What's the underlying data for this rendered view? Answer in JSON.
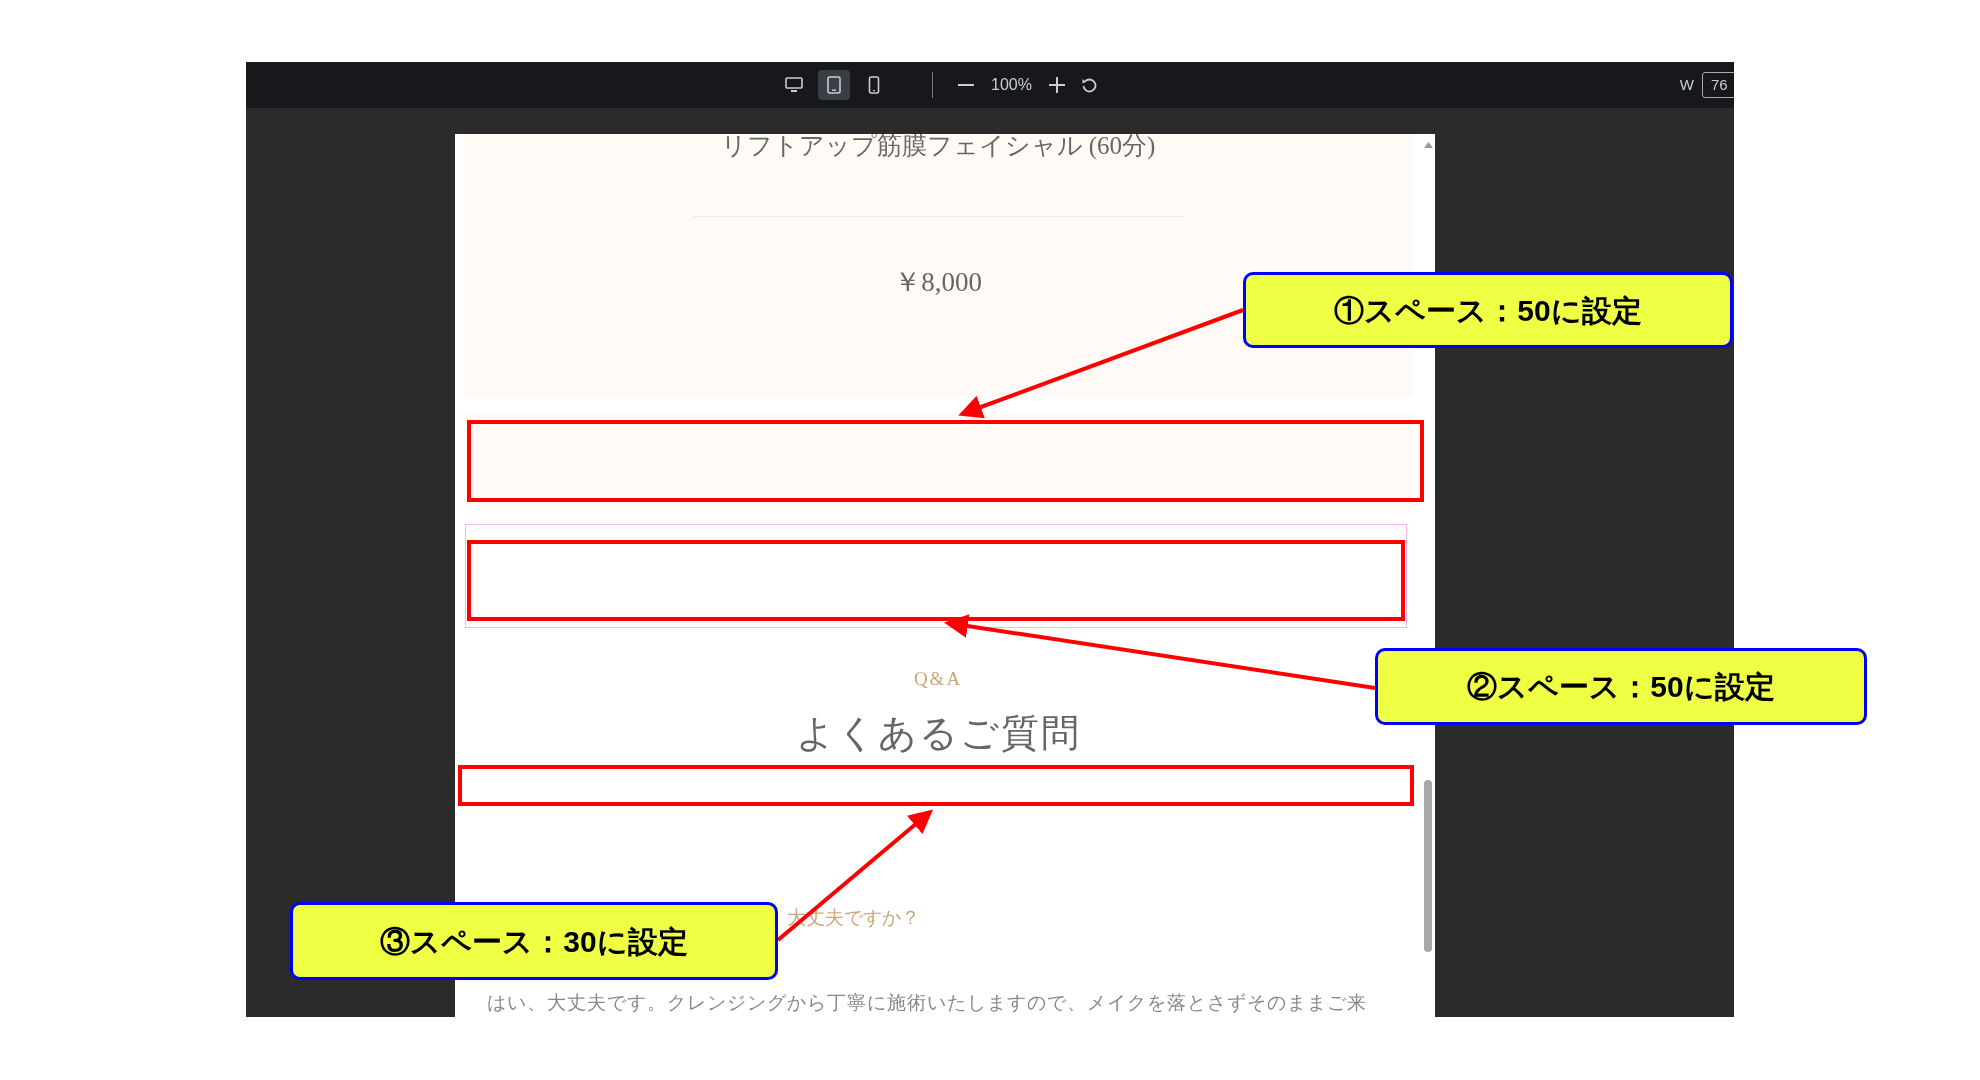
{
  "toolbar": {
    "devices": [
      {
        "kind": "desktop",
        "selected": false
      },
      {
        "kind": "tablet",
        "selected": true
      },
      {
        "kind": "mobile",
        "selected": false
      }
    ],
    "zoom": "100%",
    "width_label": "W",
    "width_value": "76"
  },
  "preview": {
    "title": "リフトアップ筋膜フェイシャル (60分)",
    "price": "￥8,000",
    "section_label": "Q&A",
    "heading": "よくあるご質問",
    "question": "大丈夫ですか？",
    "answer": "はい、大丈夫です。クレンジングから丁寧に施術いたしますので、メイクを落とさずそのままご来"
  },
  "callouts": [
    {
      "text": "①スペース：50に設定"
    },
    {
      "text": "②スペース：50に設定"
    },
    {
      "text": "③スペース：30に設定"
    }
  ]
}
